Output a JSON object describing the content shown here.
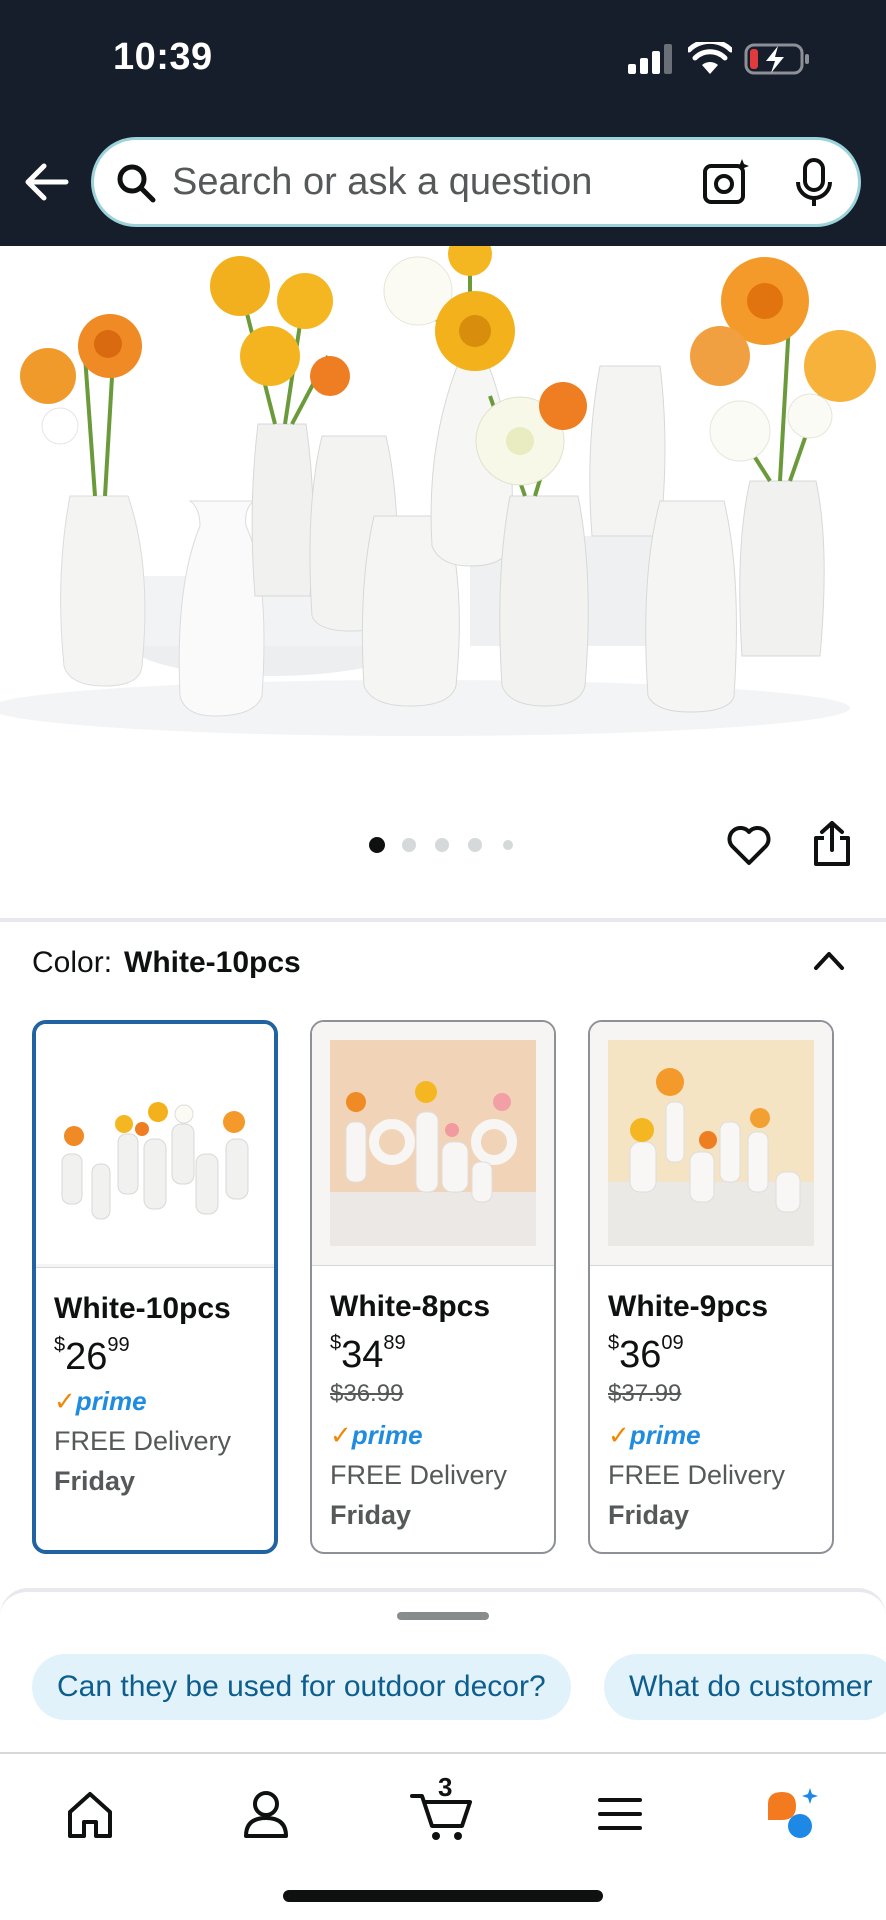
{
  "status": {
    "time": "10:39"
  },
  "search": {
    "placeholder": "Search or ask a question"
  },
  "gallery": {
    "image_count": 5,
    "active_index": 0
  },
  "color": {
    "label": "Color:",
    "value": "White-10pcs"
  },
  "options": [
    {
      "name": "White-10pcs",
      "price_symbol": "$",
      "price_whole": "26",
      "price_cents": "99",
      "list_price": "",
      "prime": "prime",
      "delivery": "FREE Delivery",
      "day": "Friday",
      "selected": true
    },
    {
      "name": "White-8pcs",
      "price_symbol": "$",
      "price_whole": "34",
      "price_cents": "89",
      "list_price": "$36.99",
      "prime": "prime",
      "delivery": "FREE Delivery",
      "day": "Friday",
      "selected": false
    },
    {
      "name": "White-9pcs",
      "price_symbol": "$",
      "price_whole": "36",
      "price_cents": "09",
      "list_price": "$37.99",
      "prime": "prime",
      "delivery": "FREE Delivery",
      "day": "Friday",
      "selected": false
    }
  ],
  "suggestions": [
    "Can they be used for outdoor decor?",
    "What do customer"
  ],
  "tabbar": {
    "cart_count": "3",
    "items": [
      "home-icon",
      "account-icon",
      "cart-icon",
      "menu-icon",
      "rufus-icon"
    ]
  },
  "colors": {
    "header": "#161d2b",
    "selected_border": "#2162a1",
    "prime_blue": "#1f8ce0",
    "chip_bg": "#e2f2fb"
  }
}
